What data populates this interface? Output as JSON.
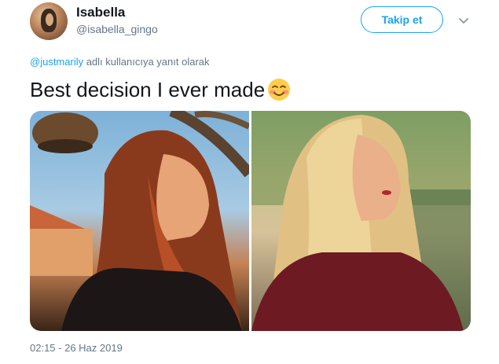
{
  "user": {
    "name": "Isabella",
    "handle": "@isabella_gingo"
  },
  "follow_button": {
    "label": "Takip et"
  },
  "reply": {
    "mention": "@justmarily",
    "suffix": " adlı kullanıcıya yanıt olarak"
  },
  "tweet": {
    "text": "Best decision I ever made",
    "emoji": "smiling-face-with-smiling-eyes"
  },
  "timestamp": "02:15 - 26 Haz 2019",
  "colors": {
    "accent": "#1da1f2",
    "secondary_text": "#657786",
    "primary_text": "#14171a"
  }
}
